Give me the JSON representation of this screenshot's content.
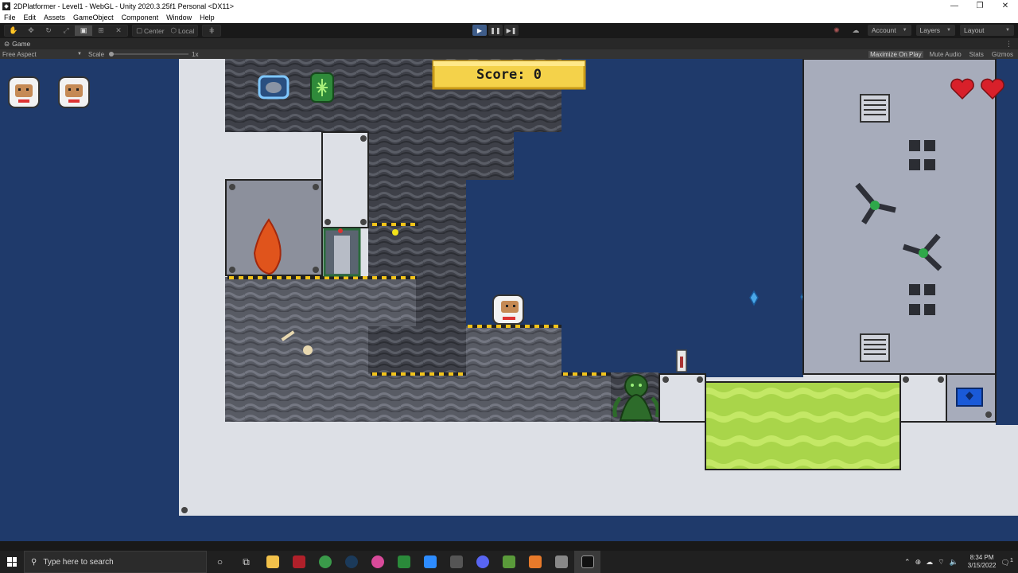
{
  "window": {
    "title": "2DPlatformer - Level1 - WebGL - Unity 2020.3.25f1 Personal <DX11>",
    "minimize": "—",
    "maximize": "❐",
    "close": "✕"
  },
  "menu": [
    "File",
    "Edit",
    "Assets",
    "GameObject",
    "Component",
    "Window",
    "Help"
  ],
  "toolbar": {
    "pivot_center": "Center",
    "pivot_local": "Local",
    "account": "Account",
    "layers": "Layers",
    "layout": "Layout"
  },
  "game_tab": {
    "label": "Game",
    "aspect": "Free Aspect",
    "scale_label": "Scale",
    "scale_value": "1x",
    "options": [
      "Maximize On Play",
      "Mute Audio",
      "Stats",
      "Gizmos"
    ]
  },
  "game": {
    "score_text": "Score: 0",
    "lives": 2,
    "hearts": 2
  },
  "taskbar": {
    "search_placeholder": "Type here to search",
    "time": "8:34 PM",
    "date": "3/15/2022",
    "notifications": "1"
  },
  "colors": {
    "sky": "#1f3a6b",
    "wall": "#dde0e6",
    "rock": "#4a4c54",
    "acid": "#b7e05a",
    "score_bg": "#f4d24a",
    "heart": "#d8202a"
  }
}
